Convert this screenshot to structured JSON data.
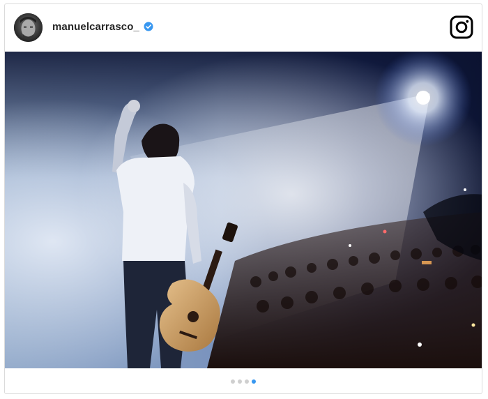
{
  "post": {
    "username": "manuelcarrasco_",
    "verified_icon": "verified-badge-icon",
    "brand_icon": "instagram-icon",
    "accent_color": "#3897f0",
    "carousel": {
      "total": 4,
      "active_index": 3
    }
  }
}
